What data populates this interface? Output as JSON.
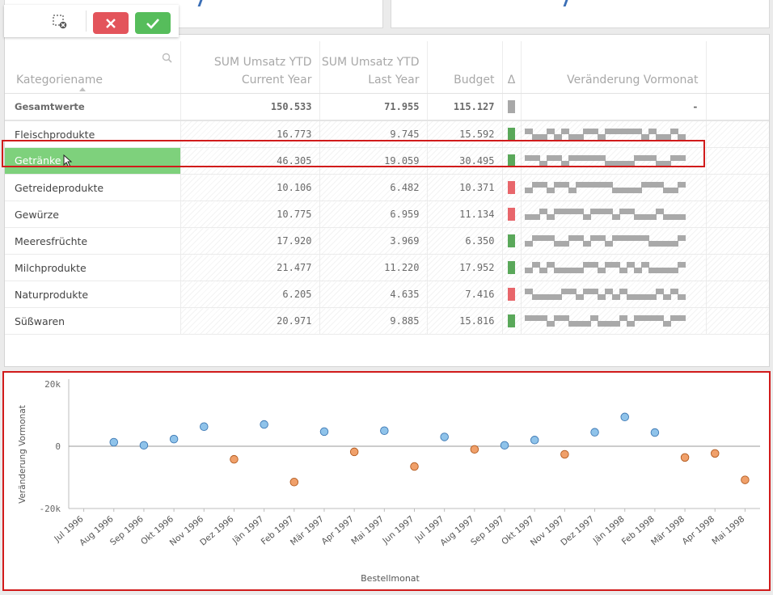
{
  "selection_toolbar": {
    "clear_icon": "lasso-clear-icon",
    "cancel_icon": "close-icon",
    "confirm_icon": "checkmark-icon"
  },
  "table": {
    "headers": {
      "category": "Kategoriename",
      "current_line1": "SUM Umsatz YTD",
      "current_line2": "Current Year",
      "last_line1": "SUM Umsatz YTD",
      "last_line2": "Last Year",
      "budget": "Budget",
      "delta": "Δ",
      "trend": "Veränderung Vormonat"
    },
    "total": {
      "label": "Gesamtwerte",
      "current": "150.533",
      "last": "71.955",
      "budget": "115.127",
      "trend": "-",
      "indicator_color": "#a8a8a8"
    },
    "rows": [
      {
        "name": "Fleischprodukte",
        "current": "16.773",
        "last": "9.745",
        "budget": "15.592",
        "status": "good"
      },
      {
        "name": "Getränke",
        "current": "46.305",
        "last": "19.059",
        "budget": "30.495",
        "status": "good",
        "selected": true
      },
      {
        "name": "Getreideprodukte",
        "current": "10.106",
        "last": "6.482",
        "budget": "10.371",
        "status": "bad"
      },
      {
        "name": "Gewürze",
        "current": "10.775",
        "last": "6.959",
        "budget": "11.134",
        "status": "bad"
      },
      {
        "name": "Meeresfrüchte",
        "current": "17.920",
        "last": "3.969",
        "budget": "6.350",
        "status": "good"
      },
      {
        "name": "Milchprodukte",
        "current": "21.477",
        "last": "11.220",
        "budget": "17.952",
        "status": "good"
      },
      {
        "name": "Naturprodukte",
        "current": "6.205",
        "last": "4.635",
        "budget": "7.416",
        "status": "bad"
      },
      {
        "name": "Süßwaren",
        "current": "20.971",
        "last": "9.885",
        "budget": "15.816",
        "status": "good"
      }
    ],
    "colors": {
      "good": "#5aa85a",
      "bad": "#e8666b",
      "selected": "#7ed17c",
      "spark": "#a9a9a9"
    }
  },
  "chart_data": {
    "type": "scatter",
    "xlabel": "Bestellmonat",
    "ylabel": "Veränderung Vormonat",
    "ylim": [
      -20000,
      20000
    ],
    "yticks": [
      {
        "v": 20000,
        "label": "20k"
      },
      {
        "v": 0,
        "label": "0"
      },
      {
        "v": -20000,
        "label": "-20k"
      }
    ],
    "categories": [
      "Jul 1996",
      "Aug 1996",
      "Sep 1996",
      "Okt 1996",
      "Nov 1996",
      "Dez 1996",
      "Jän 1997",
      "Feb 1997",
      "Mär 1997",
      "Apr 1997",
      "Mai 1997",
      "Jun 1997",
      "Jul 1997",
      "Aug 1997",
      "Sep 1997",
      "Okt 1997",
      "Nov 1997",
      "Dez 1997",
      "Jän 1998",
      "Feb 1998",
      "Mär 1998",
      "Apr 1998",
      "Mai 1998"
    ],
    "points": [
      {
        "x": "Aug 1996",
        "y": 1300
      },
      {
        "x": "Sep 1996",
        "y": 300
      },
      {
        "x": "Okt 1996",
        "y": 2300
      },
      {
        "x": "Nov 1996",
        "y": 6300
      },
      {
        "x": "Dez 1996",
        "y": -4200
      },
      {
        "x": "Jän 1997",
        "y": 7000
      },
      {
        "x": "Feb 1997",
        "y": -11500
      },
      {
        "x": "Mär 1997",
        "y": 4700
      },
      {
        "x": "Apr 1997",
        "y": -1800
      },
      {
        "x": "Mai 1997",
        "y": 5000
      },
      {
        "x": "Jun 1997",
        "y": -6500
      },
      {
        "x": "Jul 1997",
        "y": 3000
      },
      {
        "x": "Aug 1997",
        "y": -1000
      },
      {
        "x": "Sep 1997",
        "y": 300
      },
      {
        "x": "Okt 1997",
        "y": 2000
      },
      {
        "x": "Nov 1997",
        "y": -2600
      },
      {
        "x": "Dez 1997",
        "y": 4500
      },
      {
        "x": "Jän 1998",
        "y": 9400
      },
      {
        "x": "Feb 1998",
        "y": 4400
      },
      {
        "x": "Mär 1998",
        "y": -3600
      },
      {
        "x": "Apr 1998",
        "y": -2300
      },
      {
        "x": "Mai 1998",
        "y": -10800
      }
    ],
    "colors": {
      "positive": "#8fc3ea",
      "negative": "#f0a06a",
      "positive_stroke": "#3d78b3",
      "negative_stroke": "#b15a1f"
    },
    "grid": false,
    "zero_line": true
  }
}
